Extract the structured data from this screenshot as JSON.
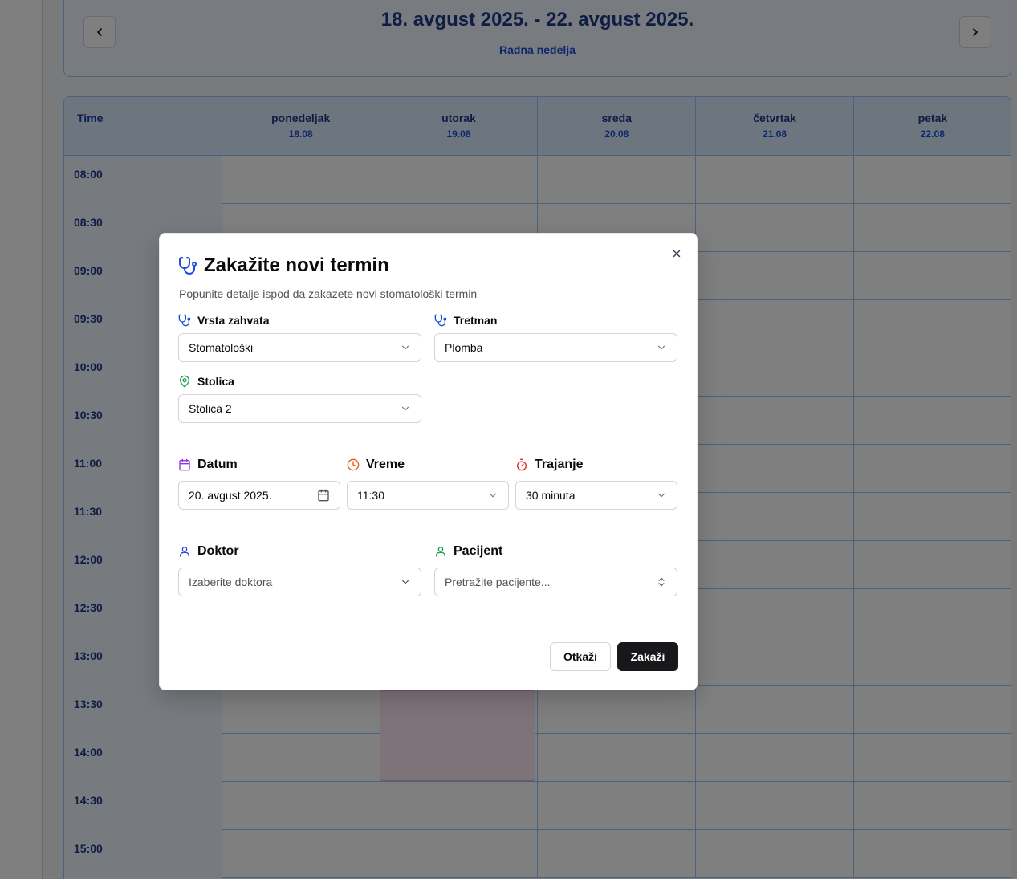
{
  "week": {
    "title": "18. avgust 2025. - 22. avgust 2025.",
    "subtitle": "Radna nedelja",
    "prev_icon": "chevron-left-icon",
    "next_icon": "chevron-right-icon"
  },
  "calendar": {
    "time_header": "Time",
    "days": [
      {
        "name": "ponedeljak",
        "date": "18.08"
      },
      {
        "name": "utorak",
        "date": "19.08"
      },
      {
        "name": "sreda",
        "date": "20.08"
      },
      {
        "name": "četvrtak",
        "date": "21.08"
      },
      {
        "name": "petak",
        "date": "22.08"
      }
    ],
    "times": [
      "08:00",
      "08:30",
      "09:00",
      "09:30",
      "10:00",
      "10:30",
      "11:00",
      "11:30",
      "12:00",
      "12:30",
      "13:00",
      "13:30",
      "14:00",
      "14:30",
      "15:00"
    ],
    "colors": {
      "accent": "#1e3a8a",
      "border": "#93c5fd",
      "appointment": "#fce7f3"
    }
  },
  "modal": {
    "title": "Zakažite novi termin",
    "description": "Popunite detalje ispod da zakazete novi stomatološki termin",
    "procedure_type": {
      "label": "Vrsta zahvata",
      "value": "Stomatološki"
    },
    "treatment": {
      "label": "Tretman",
      "value": "Plomba"
    },
    "chair": {
      "label": "Stolica",
      "value": "Stolica 2"
    },
    "date": {
      "label": "Datum",
      "value": "20. avgust 2025."
    },
    "time": {
      "label": "Vreme",
      "value": "11:30"
    },
    "duration": {
      "label": "Trajanje",
      "value": "30 minuta"
    },
    "doctor": {
      "label": "Doktor",
      "placeholder": "Izaberite doktora"
    },
    "patient": {
      "label": "Pacijent",
      "placeholder": "Pretražite pacijente..."
    },
    "cancel_label": "Otkaži",
    "submit_label": "Zakaži"
  }
}
